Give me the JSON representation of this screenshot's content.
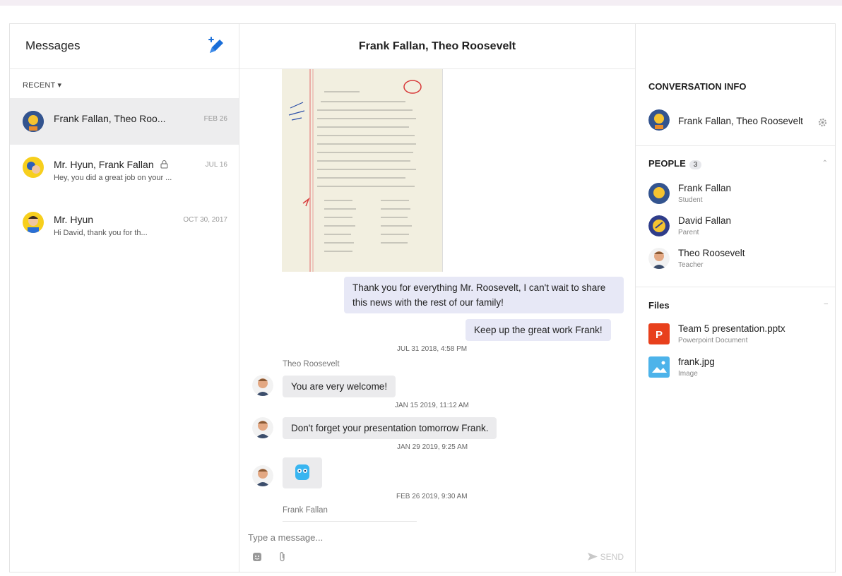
{
  "left": {
    "title": "Messages",
    "recent_label": "RECENT ▾",
    "threads": [
      {
        "name": "Frank Fallan, Theo Roo...",
        "date": "FEB 26",
        "preview": ""
      },
      {
        "name": "Mr. Hyun, Frank Fallan",
        "date": "JUL 16",
        "preview": "Hey, you did a great job on your ..."
      },
      {
        "name": "Mr. Hyun",
        "date": "OCT 30, 2017",
        "preview": "Hi David, thank you for th..."
      }
    ]
  },
  "center": {
    "title": "Frank Fallan, Theo Roosevelt",
    "messages": [
      {
        "text": "Thank you for everything Mr. Roosevelt, I can't wait to share this news with the rest of our family!"
      },
      {
        "text": "Keep up the great work Frank!"
      },
      {
        "text": "You are very welcome!"
      },
      {
        "text": "Don't forget your presentation tomorrow Frank."
      }
    ],
    "timestamps": [
      "JUL 31 2018, 4:58 PM",
      "JAN 15 2019, 11:12 AM",
      "JAN 29 2019, 9:25 AM",
      "FEB 26 2019, 9:30 AM"
    ],
    "sender_theo": "Theo Roosevelt",
    "sender_frank": "Frank Fallan",
    "input_placeholder": "Type a message...",
    "send_label": "SEND"
  },
  "right": {
    "info_title": "CONVERSATION INFO",
    "conversation_name": "Frank Fallan, Theo Roosevelt",
    "people_title": "PEOPLE",
    "people_count": "3",
    "people": [
      {
        "name": "Frank Fallan",
        "role": "Student"
      },
      {
        "name": "David Fallan",
        "role": "Parent"
      },
      {
        "name": "Theo Roosevelt",
        "role": "Teacher"
      }
    ],
    "files_title": "Files",
    "files": [
      {
        "name": "Team 5 presentation.pptx",
        "type": "Powerpoint Document"
      },
      {
        "name": "frank.jpg",
        "type": "Image"
      }
    ]
  },
  "colors": {
    "accent_blue": "#1a6ed8",
    "bubble_outgoing": "#e7e8f6",
    "bubble_incoming": "#ebebed",
    "ppt_red": "#e8401c",
    "image_blue": "#4db3ea"
  }
}
